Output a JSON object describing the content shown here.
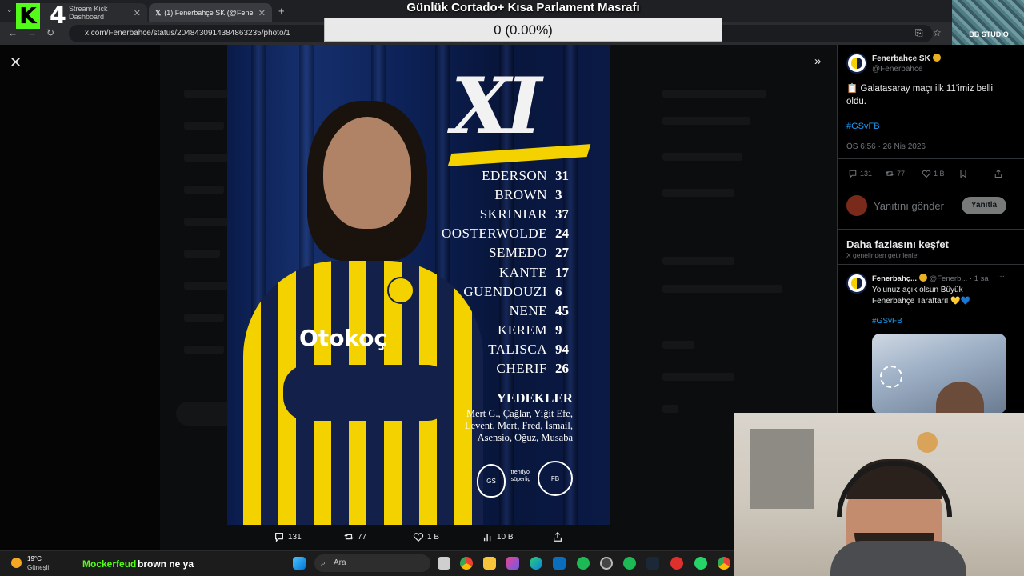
{
  "overlay": {
    "donation_title": "Günlük Cortado+ Kısa Parlament Masrafı",
    "donation_progress": "0 (0.00%)",
    "donation_fraction": 0,
    "donation_min": "0",
    "donation_max": "1",
    "kick_digit": "4",
    "studio_label": "BB STUDIO"
  },
  "browser": {
    "tabs": [
      {
        "label": "Stream Kick Dashboard"
      },
      {
        "label": "(1) Fenerbahçe SK (@Fenerbahç"
      }
    ],
    "new_tab": "+",
    "url": "x.com/Fenerbahce/status/2048430914384863235/photo/1"
  },
  "poster": {
    "sponsor_text": "Otokoç",
    "xi_label": "XI",
    "lineup": [
      {
        "name": "EDERSON",
        "number": "31"
      },
      {
        "name": "BROWN",
        "number": "3"
      },
      {
        "name": "SKRINIAR",
        "number": "37"
      },
      {
        "name": "OOSTERWOLDE",
        "number": "24"
      },
      {
        "name": "SEMEDO",
        "number": "27"
      },
      {
        "name": "KANTE",
        "number": "17"
      },
      {
        "name": "GUENDOUZI",
        "number": "6"
      },
      {
        "name": "NENE",
        "number": "45"
      },
      {
        "name": "KEREM",
        "number": "9"
      },
      {
        "name": "TALISCA",
        "number": "94"
      },
      {
        "name": "CHERIF",
        "number": "26"
      }
    ],
    "subs_title": "YEDEKLER",
    "subs_lines": [
      "Mert G., Çağlar, Yiğit Efe,",
      "Levent, Mert, Fred, İsmail,",
      "Asensio, Oğuz, Musaba"
    ],
    "league_label": "trendyol süperlig"
  },
  "media_actions": {
    "replies": "131",
    "reposts": "77",
    "likes": "1 B",
    "views": "10 B"
  },
  "tweet": {
    "author_name": "Fenerbahçe SK",
    "author_handle": "@Fenerbahce",
    "text": "📋 Galatasaray maçı ilk 11'imiz belli oldu.",
    "hashtag": "#GSvFB",
    "timestamp": "ÖS 6:56 · 26 Nis 2026",
    "stats": {
      "replies": "131",
      "reposts": "77",
      "likes": "1 B"
    }
  },
  "reply": {
    "placeholder": "Yanıtını gönder",
    "button": "Yanıtla"
  },
  "explore": {
    "title": "Daha fazlasını keşfet",
    "subtitle": "X genelinden getirilenler",
    "post": {
      "author": "Fenerbahç...",
      "meta": "@Fenerb... · 1 sa",
      "more": "···",
      "text": "Yolunuz açık olsun Büyük Fenerbahçe Taraftarı! 💛💙",
      "hashtag": "#GSvFB"
    }
  },
  "taskbar": {
    "weather_temp": "19°C",
    "weather_desc": "Güneşli",
    "search_placeholder": "Ara",
    "chat_user": "Mockerfeud",
    "chat_message": "brown ne ya"
  },
  "colors": {
    "kick_green": "#53fc18",
    "link_blue": "#1d9bf0",
    "fb_yellow": "#f3d200",
    "fb_navy": "#13204a"
  }
}
